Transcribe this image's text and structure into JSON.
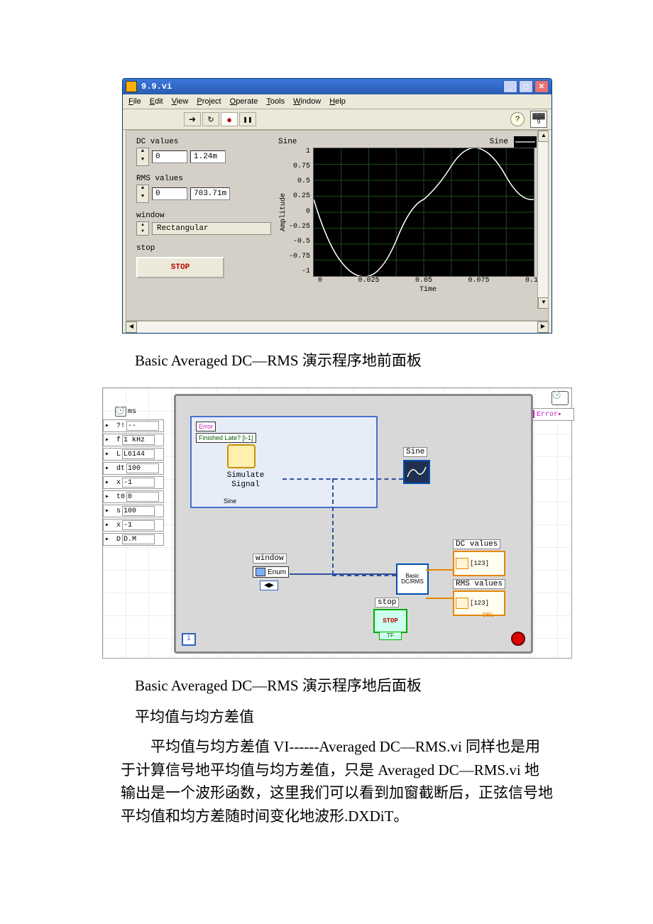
{
  "window": {
    "title": "9.9.vi",
    "menus": [
      "File",
      "Edit",
      "View",
      "Project",
      "Operate",
      "Tools",
      "Window",
      "Help"
    ],
    "lv_badge_top": "▓▓▓",
    "lv_badge_bottom": "9"
  },
  "controls": {
    "dc": {
      "label": "DC values",
      "index": "0",
      "value": "1.24m"
    },
    "rms": {
      "label": "RMS values",
      "index": "0",
      "value": "703.71m"
    },
    "window": {
      "label": "window",
      "value": "Rectangular"
    },
    "stop": {
      "label": "stop",
      "button": "STOP"
    }
  },
  "graph": {
    "title": "Sine",
    "legend": "Sine",
    "y_label": "Amplitude",
    "x_label": "Time",
    "y_ticks": [
      "1",
      "0.75",
      "0.5",
      "0.25",
      "0",
      "-0.25",
      "-0.5",
      "-0.75",
      "-1"
    ],
    "x_ticks": [
      "0",
      "0.025",
      "0.05",
      "0.075",
      "0.1"
    ]
  },
  "block_diagram": {
    "clock_unit": "ms",
    "left_terms": [
      {
        "tag": "?!",
        "val": "--"
      },
      {
        "tag": "f",
        "val": "1 kHz"
      },
      {
        "tag": "L",
        "val": "L6144"
      },
      {
        "tag": "dt",
        "val": "100"
      },
      {
        "tag": "x",
        "val": "-1"
      },
      {
        "tag": "t0",
        "val": "0"
      },
      {
        "tag": "s",
        "val": "100"
      },
      {
        "tag": "x",
        "val": "-1"
      },
      {
        "tag": "D",
        "val": "D.M"
      }
    ],
    "inner_error": "Error",
    "inner_finished": "Finished Late? [i-1]",
    "simulate_label": "Simulate\nSignal",
    "simulate_out": "Sine",
    "sine_label": "Sine",
    "window_label": "window",
    "enum_label": "Enum",
    "basic_label": "Basic\nDC/RMS",
    "dc_label": "DC values",
    "rms_label": "RMS values",
    "stop_label": "stop",
    "stop_btn": "STOP",
    "array_tag": "[123]",
    "dbl_tag": "DBL",
    "loop_i": "i",
    "error_out": "Error"
  },
  "captions": {
    "front": "Basic Averaged DC—RMS 演示程序地前面板",
    "back": "Basic Averaged DC—RMS 演示程序地后面板"
  },
  "text": {
    "heading": "平均值与均方差值",
    "paragraph": "平均值与均方差值 VI------Averaged DC—RMS.vi 同样也是用于计算信号地平均值与均方差值，只是 Averaged DC—RMS.vi 地输出是一个波形函数，这里我们可以看到加窗截断后，正弦信号地平均值和均方差随时间变化地波形.DXDiT。"
  },
  "chart_data": {
    "type": "line",
    "title": "Sine",
    "xlabel": "Time",
    "ylabel": "Amplitude",
    "x": [
      0,
      0.0125,
      0.025,
      0.0375,
      0.05,
      0.0625,
      0.075,
      0.0875,
      0.1
    ],
    "values": [
      0.2,
      -0.6,
      -1.0,
      -0.6,
      0.2,
      0.8,
      1.0,
      0.8,
      0.2
    ],
    "xlim": [
      0,
      0.1
    ],
    "ylim": [
      -1,
      1
    ],
    "series": [
      {
        "name": "Sine",
        "color": "#ffffff"
      }
    ]
  }
}
